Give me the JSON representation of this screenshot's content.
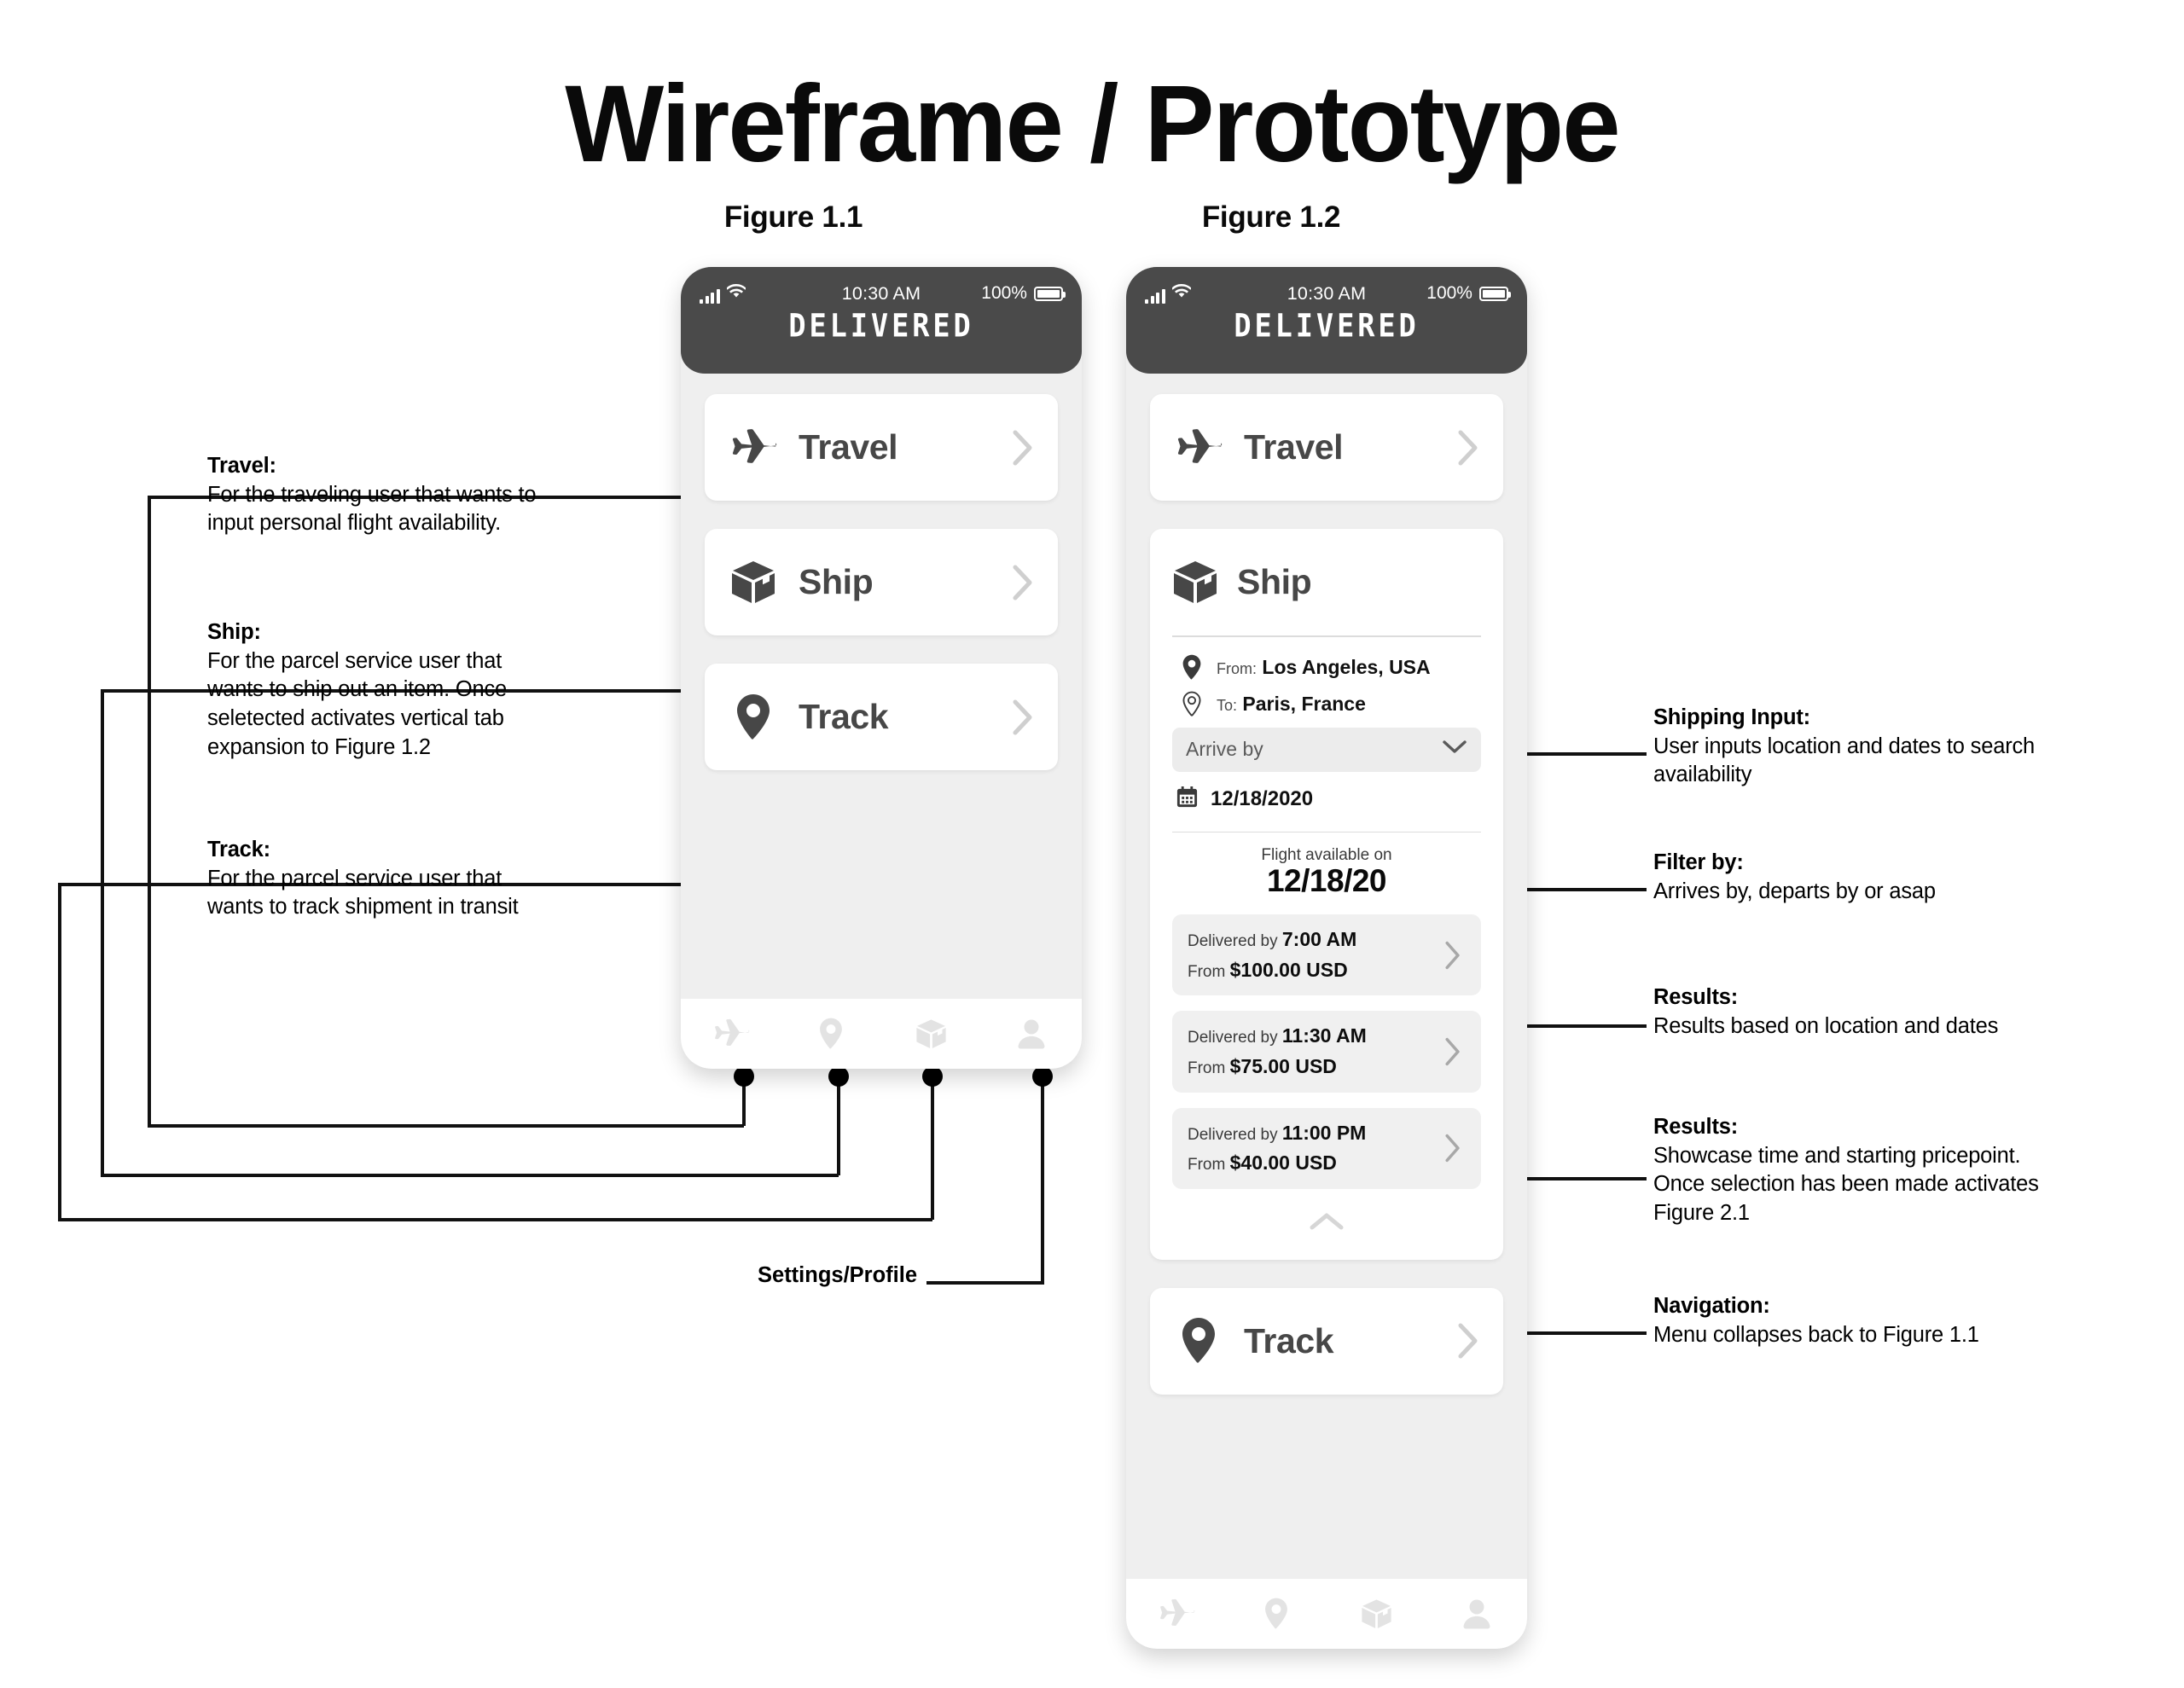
{
  "page": {
    "title": "Wireframe / Prototype",
    "figure_1_label": "Figure 1.1",
    "figure_2_label": "Figure 1.2"
  },
  "phone": {
    "status_bar": {
      "time": "10:30 AM",
      "battery_percent": "100%",
      "signal_icon": "signal-bars-icon",
      "wifi_icon": "wifi-icon",
      "battery_icon": "battery-icon"
    },
    "brand": "DELIVERED",
    "tab_bar": [
      {
        "name": "tab-travel",
        "icon": "airplane-icon"
      },
      {
        "name": "tab-track",
        "icon": "location-pin-icon"
      },
      {
        "name": "tab-ship",
        "icon": "box-icon"
      },
      {
        "name": "tab-profile",
        "icon": "person-icon"
      }
    ]
  },
  "figure_1_1": {
    "menu": [
      {
        "label": "Travel",
        "icon": "airplane-icon",
        "chevron": "chevron-right-icon"
      },
      {
        "label": "Ship",
        "icon": "box-icon",
        "chevron": "chevron-right-icon"
      },
      {
        "label": "Track",
        "icon": "location-pin-icon",
        "chevron": "chevron-right-icon"
      }
    ]
  },
  "figure_1_2": {
    "travel": {
      "label": "Travel",
      "icon": "airplane-icon",
      "chevron": "chevron-right-icon"
    },
    "ship": {
      "label": "Ship",
      "icon": "box-icon",
      "from_key": "From:",
      "from_value": "Los Angeles, USA",
      "to_key": "To:",
      "to_value": "Paris, France",
      "filter_selected": "Arrive by",
      "filter_chevron": "chevron-down-icon",
      "date_value": "12/18/2020",
      "date_icon": "calendar-icon",
      "availability_caption": "Flight available on",
      "availability_date": "12/18/20",
      "results": [
        {
          "time_label": "Delivered by",
          "time_value": "7:00 AM",
          "price_label": "From",
          "price_value": "$100.00 USD"
        },
        {
          "time_label": "Delivered by",
          "time_value": "11:30 AM",
          "price_label": "From",
          "price_value": "$75.00 USD"
        },
        {
          "time_label": "Delivered by",
          "time_value": "11:00 PM",
          "price_label": "From",
          "price_value": "$40.00 USD"
        }
      ],
      "collapse_icon": "chevron-up-icon"
    },
    "track": {
      "label": "Track",
      "icon": "location-pin-icon",
      "chevron": "chevron-right-icon"
    }
  },
  "annotations": {
    "travel": {
      "heading": "Travel:",
      "body": "For the traveling user that wants to input personal flight availability."
    },
    "ship": {
      "heading": "Ship:",
      "body": "For the parcel service user that wants to ship out an item. Once seletected activates vertical tab expansion to Figure 1.2"
    },
    "track": {
      "heading": "Track:",
      "body": "For the parcel service user that wants to track shipment in transit"
    },
    "settings": {
      "heading": "Settings/Profile"
    },
    "shipping_input": {
      "heading": "Shipping Input:",
      "body": "User inputs location and dates to search availability"
    },
    "filter_by": {
      "heading": "Filter by:",
      "body": "Arrives by, departs by or asap"
    },
    "results_1": {
      "heading": "Results:",
      "body": "Results based on location and dates"
    },
    "results_2": {
      "heading": "Results:",
      "body": "Showcase time and starting pricepoint. Once selection has been made activates Figure 2.1"
    },
    "navigation": {
      "heading": "Navigation:",
      "body": "Menu collapses back to Figure 1.1"
    }
  },
  "colors": {
    "background": "#ffffff",
    "status_bar": "#4a4a4a",
    "screen": "#efefef",
    "card": "#ffffff",
    "icon_dark": "#474747",
    "icon_light": "#e3e3e3",
    "chevron": "#cfcfcf",
    "line": "#111111"
  }
}
